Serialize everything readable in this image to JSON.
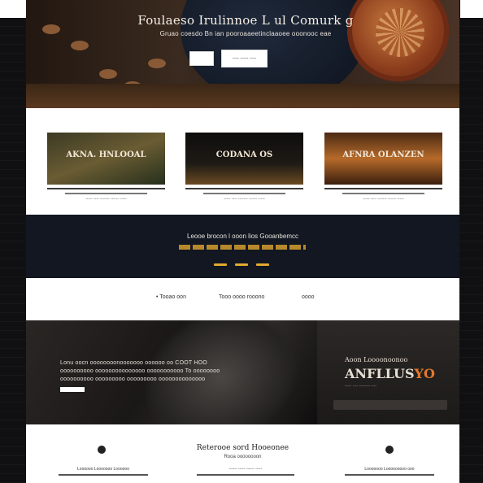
{
  "hero": {
    "title": "Foulaeso Irulinnoe L ul Comurk g",
    "subtitle": "Gruao coesdo Bn ian pooroaaeetinclaaoee ooonooc eae",
    "primary_button": "",
    "secondary_button": "---- ----- ----"
  },
  "cards": [
    {
      "image_text": "AKNA. HNLOOAL",
      "caption": "----- ---- ------- ------ -----"
    },
    {
      "image_text": "CODANA OS",
      "caption": "----- ---- ------- ------ -----"
    },
    {
      "image_text": "AFNRA OLANZEN",
      "caption": "----- ---- ------- ------ -----"
    }
  ],
  "band": {
    "title": "Leooe brocon l ooon lios Gooanbemcc"
  },
  "nav": {
    "item1": "• Tooao oon",
    "item2": "Tooo oooo rooono",
    "item3": "oooo"
  },
  "feature": {
    "text_line1": "Lonu oocn oooooooonooooooo oooooo oo COOT HOO",
    "text_line2": "oooooooooo ooooooooooooooo ooooooooooo To oooooooo",
    "text_line3": "oooooooooo ooooooooo ooooooooo oooooooooooooo",
    "heading": "Aoon Loooonoonoo",
    "big_text_main": "ANFLLUS",
    "big_text_accent": "YO",
    "small_text": "----- ---- -------- ----"
  },
  "footer": {
    "title": "Reterooe sord Hooeonee",
    "subtitle": "Rooa oooooooon",
    "col1": "Loooooo Looooooo Loooooo",
    "col2": "------ ----- ------ -----",
    "col3": "Looooooo Looooooooo ooo"
  },
  "colors": {
    "accent": "#e2a930",
    "dark_band": "#121722",
    "orange": "#e4792b"
  }
}
